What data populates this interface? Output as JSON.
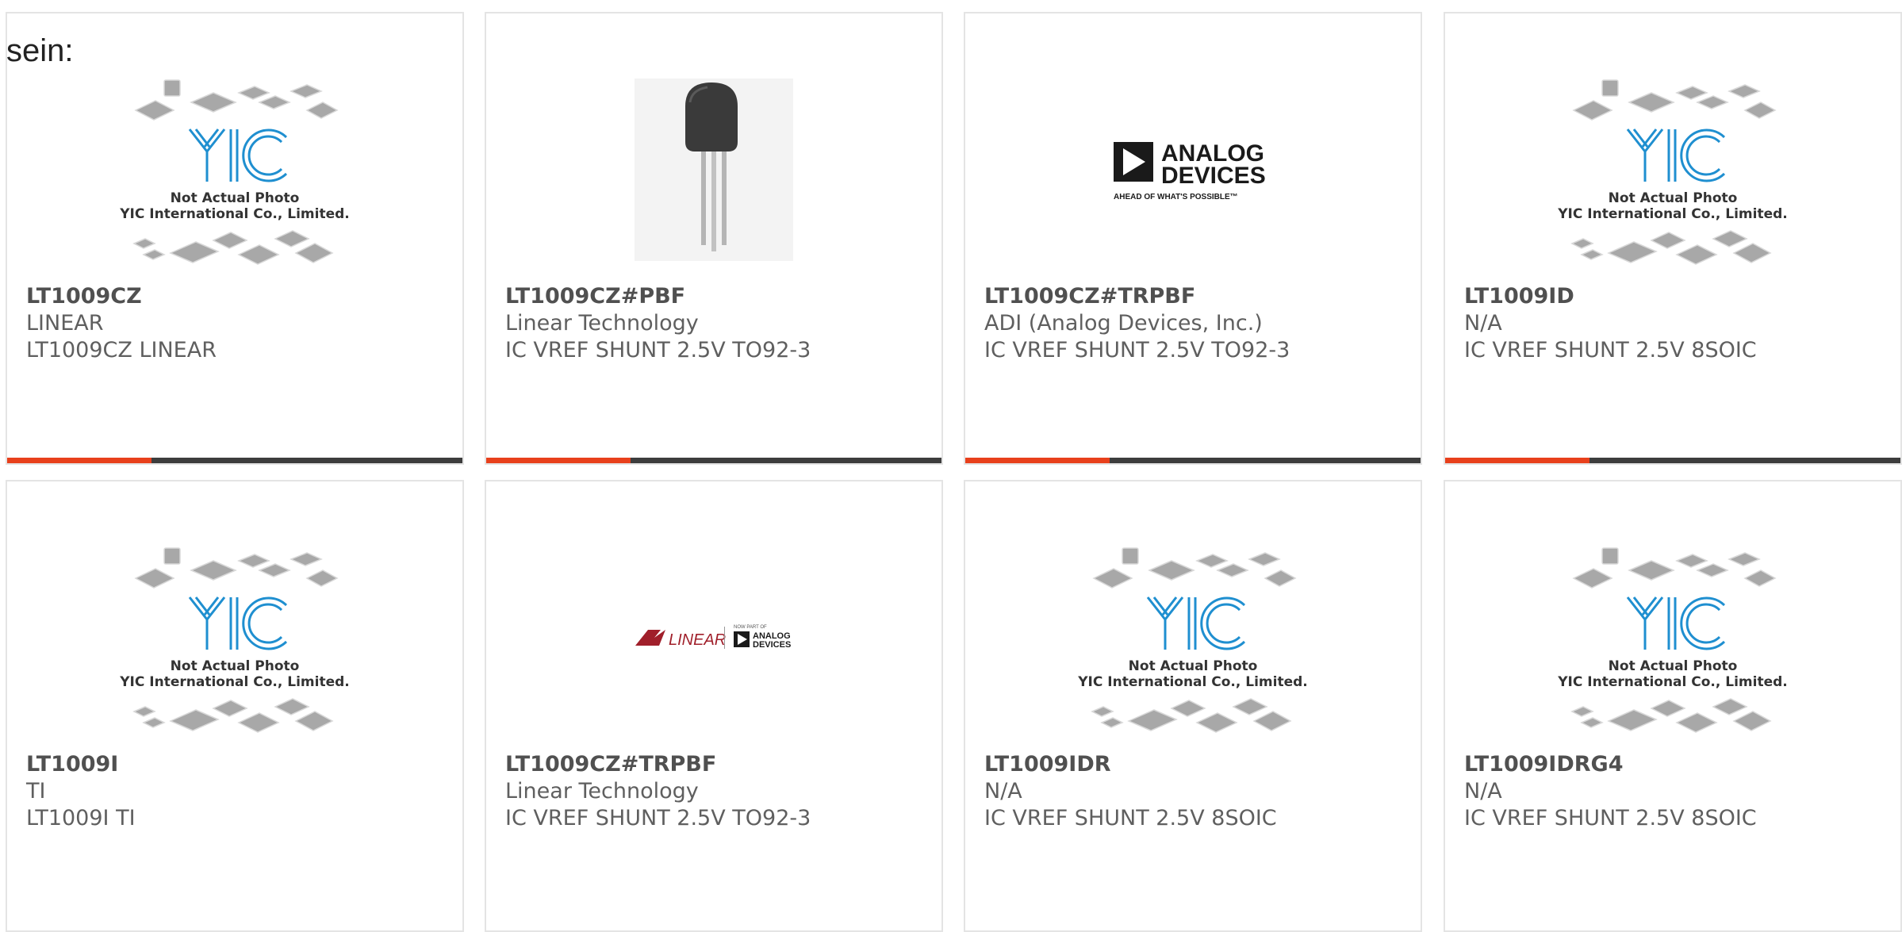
{
  "prefix": "sein:",
  "placeholder": {
    "line1": "Not Actual Photo",
    "line2": "YIC International Co., Limited.",
    "mark": "YIC"
  },
  "logos": {
    "analog_devices": {
      "line1": "ANALOG",
      "line2": "DEVICES",
      "tagline": "AHEAD OF WHAT'S POSSIBLE™"
    },
    "linear_adi": {
      "small_top": "NOW PART OF",
      "linear": "LINEAR",
      "analog": "ANALOG",
      "devices": "DEVICES"
    }
  },
  "colors": {
    "accent": "#e8401c",
    "bar": "#3d3d3d",
    "border": "#e4e4e4",
    "yic_blue": "#1f8fd0"
  },
  "products": [
    {
      "part": "LT1009CZ",
      "maker": "LINEAR",
      "desc": "LT1009CZ LINEAR",
      "image": "yic-placeholder"
    },
    {
      "part": "LT1009CZ#PBF",
      "maker": "Linear Technology",
      "desc": "IC VREF SHUNT 2.5V TO92-3",
      "image": "to92-transistor-photo"
    },
    {
      "part": "LT1009CZ#TRPBF",
      "maker": "ADI (Analog Devices, Inc.)",
      "desc": "IC VREF SHUNT 2.5V TO92-3",
      "image": "analog-devices-logo"
    },
    {
      "part": "LT1009ID",
      "maker": "N/A",
      "desc": "IC VREF SHUNT 2.5V 8SOIC",
      "image": "yic-placeholder"
    },
    {
      "part": "LT1009I",
      "maker": "TI",
      "desc": "LT1009I TI",
      "image": "yic-placeholder"
    },
    {
      "part": "LT1009CZ#TRPBF",
      "maker": "Linear Technology",
      "desc": "IC VREF SHUNT 2.5V TO92-3",
      "image": "linear-adi-logo"
    },
    {
      "part": "LT1009IDR",
      "maker": "N/A",
      "desc": "IC VREF SHUNT 2.5V 8SOIC",
      "image": "yic-placeholder"
    },
    {
      "part": "LT1009IDRG4",
      "maker": "N/A",
      "desc": "IC VREF SHUNT 2.5V 8SOIC",
      "image": "yic-placeholder"
    }
  ]
}
